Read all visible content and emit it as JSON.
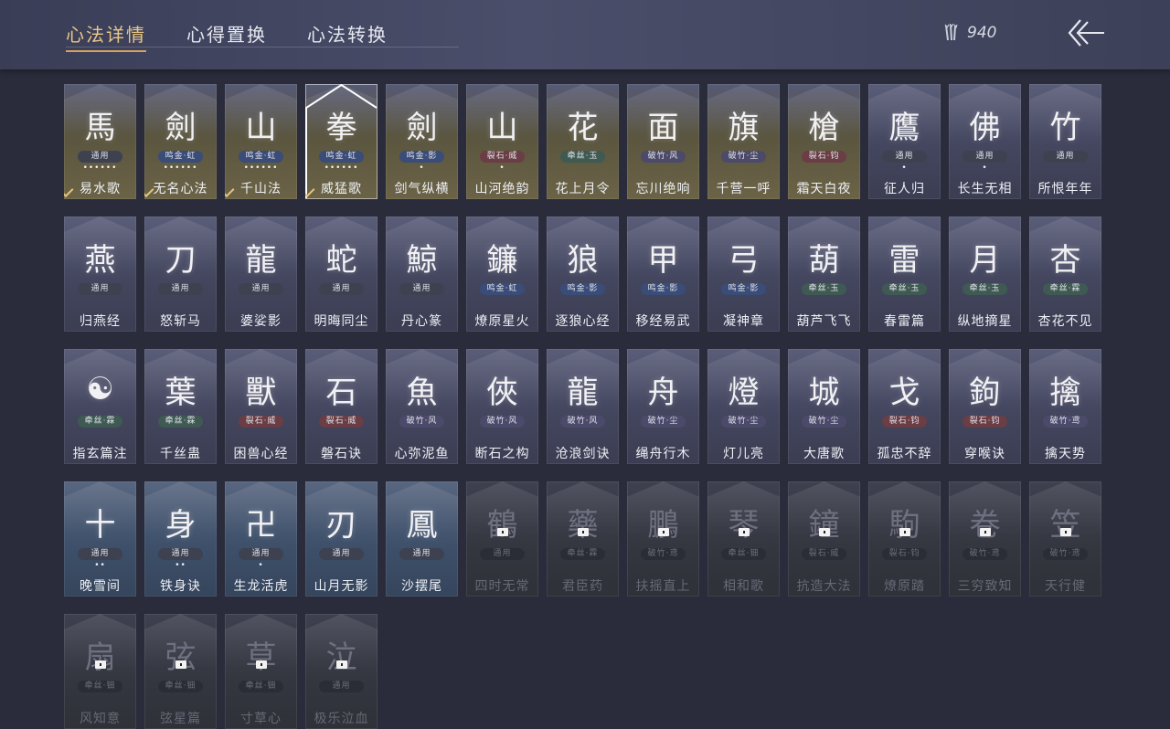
{
  "header": {
    "tabs": [
      {
        "label": "心法详情",
        "active": true
      },
      {
        "label": "心得置换",
        "active": false
      },
      {
        "label": "心法转换",
        "active": false
      }
    ],
    "currency": {
      "icon": "arrows-icon",
      "value": "940"
    },
    "back_icon": "back-arrow-icon"
  },
  "colors": {
    "accent": "#e9c787",
    "background": "#2a2c3c"
  },
  "cards": [
    {
      "name": "易水歌",
      "tag": "通用",
      "dots": "••••••",
      "glyph": "馬",
      "style": "gold",
      "checked": true
    },
    {
      "name": "无名心法",
      "tag": "鸣金·虹",
      "dots": "••••••",
      "glyph": "劍",
      "style": "gold",
      "checked": true
    },
    {
      "name": "千山法",
      "tag": "鸣金·虹",
      "dots": "••••••",
      "glyph": "山",
      "style": "gold",
      "checked": true
    },
    {
      "name": "威猛歌",
      "tag": "鸣金·虹",
      "dots": "••••••",
      "glyph": "拳",
      "style": "gold",
      "checked": true,
      "selected": true
    },
    {
      "name": "剑气纵横",
      "tag": "鸣金·影",
      "dots": "•",
      "glyph": "劍",
      "style": "gold"
    },
    {
      "name": "山河绝韵",
      "tag": "裂石·威",
      "dots": "•",
      "glyph": "山",
      "style": "gold"
    },
    {
      "name": "花上月令",
      "tag": "牵丝·玉",
      "dots": "",
      "glyph": "花",
      "style": "gold"
    },
    {
      "name": "忘川绝响",
      "tag": "破竹·风",
      "dots": "",
      "glyph": "面",
      "style": "gold"
    },
    {
      "name": "千营一呼",
      "tag": "破竹·尘",
      "dots": "",
      "glyph": "旗",
      "style": "gold"
    },
    {
      "name": "霜天白夜",
      "tag": "裂石·钧",
      "dots": "",
      "glyph": "槍",
      "style": "gold"
    },
    {
      "name": "征人归",
      "tag": "通用",
      "dots": "•",
      "glyph": "鷹",
      "style": ""
    },
    {
      "name": "长生无相",
      "tag": "通用",
      "dots": "•",
      "glyph": "佛",
      "style": ""
    },
    {
      "name": "所恨年年",
      "tag": "通用",
      "dots": "",
      "glyph": "竹",
      "style": ""
    },
    {
      "name": "归燕经",
      "tag": "通用",
      "dots": "",
      "glyph": "燕",
      "style": ""
    },
    {
      "name": "怒斩马",
      "tag": "通用",
      "dots": "",
      "glyph": "刀",
      "style": ""
    },
    {
      "name": "婆娑影",
      "tag": "通用",
      "dots": "",
      "glyph": "龍",
      "style": ""
    },
    {
      "name": "明晦同尘",
      "tag": "通用",
      "dots": "",
      "glyph": "蛇",
      "style": ""
    },
    {
      "name": "丹心篆",
      "tag": "通用",
      "dots": "",
      "glyph": "鯨",
      "style": ""
    },
    {
      "name": "燎原星火",
      "tag": "鸣金·虹",
      "dots": "",
      "glyph": "鐮",
      "style": ""
    },
    {
      "name": "逐狼心经",
      "tag": "鸣金·影",
      "dots": "",
      "glyph": "狼",
      "style": ""
    },
    {
      "name": "移经易武",
      "tag": "鸣金·影",
      "dots": "",
      "glyph": "甲",
      "style": ""
    },
    {
      "name": "凝神章",
      "tag": "鸣金·影",
      "dots": "",
      "glyph": "弓",
      "style": ""
    },
    {
      "name": "葫芦飞飞",
      "tag": "牵丝·玉",
      "dots": "",
      "glyph": "葫",
      "style": ""
    },
    {
      "name": "春雷篇",
      "tag": "牵丝·玉",
      "dots": "",
      "glyph": "雷",
      "style": ""
    },
    {
      "name": "纵地摘星",
      "tag": "牵丝·玉",
      "dots": "",
      "glyph": "月",
      "style": ""
    },
    {
      "name": "杏花不见",
      "tag": "牵丝·霖",
      "dots": "",
      "glyph": "杏",
      "style": ""
    },
    {
      "name": "指玄篇注",
      "tag": "牵丝·霖",
      "dots": "",
      "glyph": "☯",
      "style": ""
    },
    {
      "name": "千丝蛊",
      "tag": "牵丝·霖",
      "dots": "",
      "glyph": "葉",
      "style": ""
    },
    {
      "name": "困兽心经",
      "tag": "裂石·威",
      "dots": "",
      "glyph": "獸",
      "style": ""
    },
    {
      "name": "磐石诀",
      "tag": "裂石·威",
      "dots": "",
      "glyph": "石",
      "style": ""
    },
    {
      "name": "心弥泥鱼",
      "tag": "破竹·风",
      "dots": "",
      "glyph": "魚",
      "style": ""
    },
    {
      "name": "断石之构",
      "tag": "破竹·风",
      "dots": "",
      "glyph": "俠",
      "style": ""
    },
    {
      "name": "沧浪剑诀",
      "tag": "破竹·风",
      "dots": "",
      "glyph": "龍",
      "style": ""
    },
    {
      "name": "绳舟行木",
      "tag": "破竹·尘",
      "dots": "",
      "glyph": "舟",
      "style": ""
    },
    {
      "name": "灯儿亮",
      "tag": "破竹·尘",
      "dots": "",
      "glyph": "燈",
      "style": ""
    },
    {
      "name": "大唐歌",
      "tag": "破竹·尘",
      "dots": "",
      "glyph": "城",
      "style": ""
    },
    {
      "name": "孤忠不辞",
      "tag": "裂石·钧",
      "dots": "",
      "glyph": "戈",
      "style": ""
    },
    {
      "name": "穿喉诀",
      "tag": "裂石·钧",
      "dots": "",
      "glyph": "鉤",
      "style": ""
    },
    {
      "name": "擒天势",
      "tag": "破竹·鸢",
      "dots": "",
      "glyph": "擒",
      "style": ""
    },
    {
      "name": "晚雪间",
      "tag": "通用",
      "dots": "••",
      "glyph": "十",
      "style": "blue"
    },
    {
      "name": "铁身诀",
      "tag": "通用",
      "dots": "••",
      "glyph": "身",
      "style": "blue"
    },
    {
      "name": "生龙活虎",
      "tag": "通用",
      "dots": "•",
      "glyph": "卍",
      "style": "blue"
    },
    {
      "name": "山月无影",
      "tag": "通用",
      "dots": "",
      "glyph": "刃",
      "style": "blue"
    },
    {
      "name": "沙摆尾",
      "tag": "通用",
      "dots": "",
      "glyph": "鳳",
      "style": "blue"
    },
    {
      "name": "四时无常",
      "tag": "通用",
      "dots": "",
      "glyph": "鶴",
      "style": "dim",
      "locked": true
    },
    {
      "name": "君臣药",
      "tag": "牵丝·霖",
      "dots": "",
      "glyph": "藥",
      "style": "dim",
      "locked": true
    },
    {
      "name": "扶摇直上",
      "tag": "破竹·鸢",
      "dots": "",
      "glyph": "鵬",
      "style": "dim",
      "locked": true
    },
    {
      "name": "相和歌",
      "tag": "牵丝·钿",
      "dots": "",
      "glyph": "琴",
      "style": "dim",
      "locked": true
    },
    {
      "name": "抗造大法",
      "tag": "裂石·威",
      "dots": "",
      "glyph": "鐘",
      "style": "dim",
      "locked": true
    },
    {
      "name": "燎原踏",
      "tag": "裂石·钧",
      "dots": "",
      "glyph": "駒",
      "style": "dim",
      "locked": true
    },
    {
      "name": "三穷致知",
      "tag": "破竹·鸢",
      "dots": "",
      "glyph": "卷",
      "style": "dim",
      "locked": true
    },
    {
      "name": "天行健",
      "tag": "破竹·鸢",
      "dots": "",
      "glyph": "笠",
      "style": "dim",
      "locked": true
    },
    {
      "name": "风知意",
      "tag": "牵丝·钿",
      "dots": "",
      "glyph": "扇",
      "style": "dim",
      "locked": true
    },
    {
      "name": "弦星篇",
      "tag": "牵丝·钿",
      "dots": "",
      "glyph": "弦",
      "style": "dim",
      "locked": true
    },
    {
      "name": "寸草心",
      "tag": "牵丝·钿",
      "dots": "",
      "glyph": "草",
      "style": "dim",
      "locked": true
    },
    {
      "name": "极乐泣血",
      "tag": "通用",
      "dots": "",
      "glyph": "泣",
      "style": "dim",
      "locked": true
    }
  ]
}
